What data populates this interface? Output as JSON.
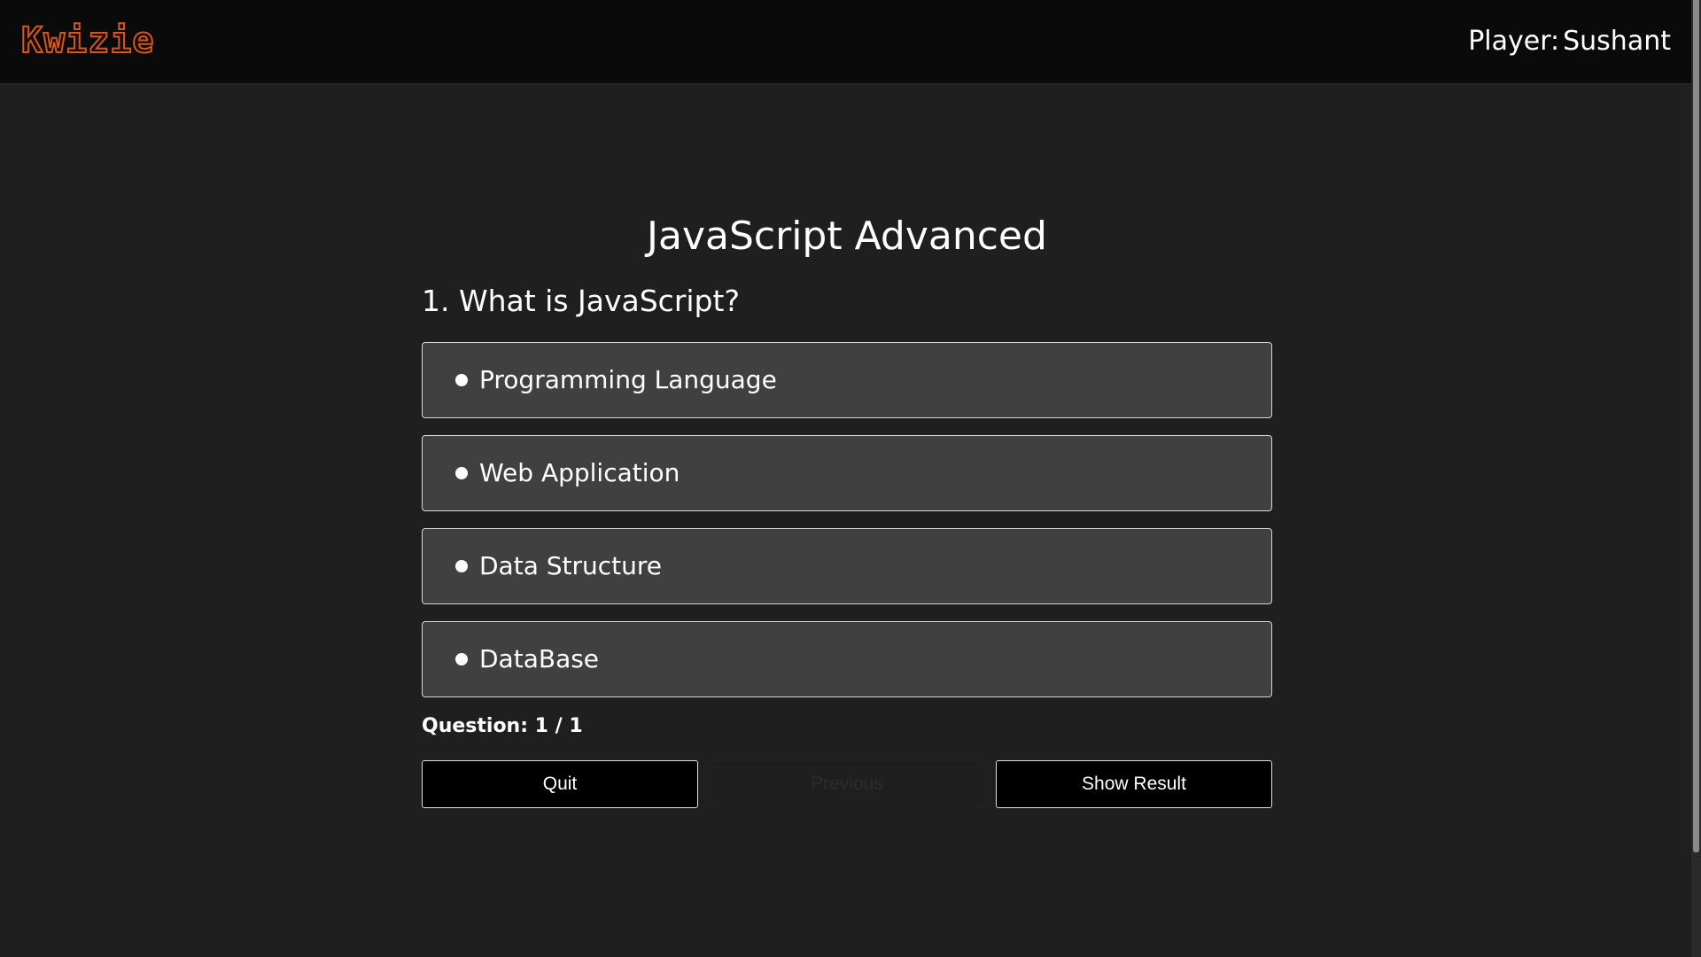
{
  "header": {
    "logo": "Kwizie",
    "player_label": "Player:",
    "player_name": "Sushant"
  },
  "quiz": {
    "title": "JavaScript Advanced",
    "question": "1. What is JavaScript?",
    "options": [
      {
        "label": "Programming Language",
        "selected": false
      },
      {
        "label": "Web Application",
        "selected": false
      },
      {
        "label": "Data Structure",
        "selected": false
      },
      {
        "label": "DataBase",
        "selected": false
      }
    ],
    "progress": "Question: 1 / 1"
  },
  "buttons": {
    "quit": "Quit",
    "previous": "Previous",
    "show_result": "Show Result"
  },
  "colors": {
    "header_bg": "#0a0a0a",
    "page_bg": "#1f1f1f",
    "option_bg": "#404040",
    "logo_accent": "#d2581f"
  }
}
